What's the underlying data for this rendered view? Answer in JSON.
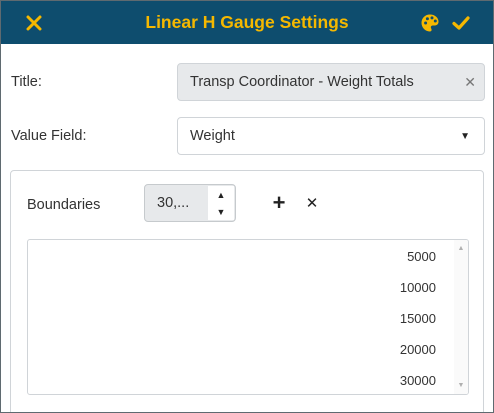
{
  "header": {
    "title": "Linear H Gauge Settings",
    "close_icon": "close-icon",
    "palette_icon": "palette-icon",
    "confirm_icon": "checkmark-icon",
    "background_color": "#0e4d6e",
    "accent_color": "#f5b800"
  },
  "form": {
    "title_label": "Title:",
    "title_value": "Transp Coordinator - Weight Totals",
    "title_clear_symbol": "✕",
    "value_field_label": "Value Field:",
    "value_field_value": "Weight",
    "value_field_arrow": "▼"
  },
  "boundaries": {
    "label": "Boundaries",
    "input_value": "30,...",
    "spin_up": "▲",
    "spin_down": "▼",
    "add_symbol": "+",
    "remove_symbol": "✕",
    "items": [
      "5000",
      "10000",
      "15000",
      "20000",
      "30000"
    ],
    "scroll_up": "▲",
    "scroll_down": "▼"
  }
}
